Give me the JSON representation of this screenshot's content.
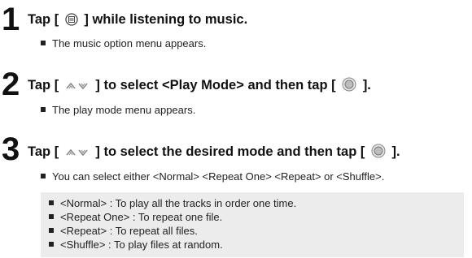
{
  "steps": [
    {
      "number": "1",
      "title_pre": "Tap [",
      "title_post": "] while listening to music.",
      "bullet": "The music option menu appears."
    },
    {
      "number": "2",
      "title_pre": "Tap [",
      "title_mid": "] to select <Play Mode> and then tap [",
      "title_post": "].",
      "bullet": "The play mode menu appears."
    },
    {
      "number": "3",
      "title_pre": "Tap [",
      "title_mid": "] to select the desired mode and then tap [",
      "title_post": "].",
      "bullet": "You can select either <Normal> <Repeat One> <Repeat> or <Shuffle>."
    }
  ],
  "notes": [
    "<Normal> : To play all the tracks in order one time.",
    "<Repeat One> : To repeat one file.",
    "<Repeat> : To repeat all files.",
    "<Shuffle> : To play files at random."
  ],
  "icons": {
    "menu": "menu-icon",
    "updown": "up-down-arrows-icon",
    "select": "select-button-icon"
  }
}
